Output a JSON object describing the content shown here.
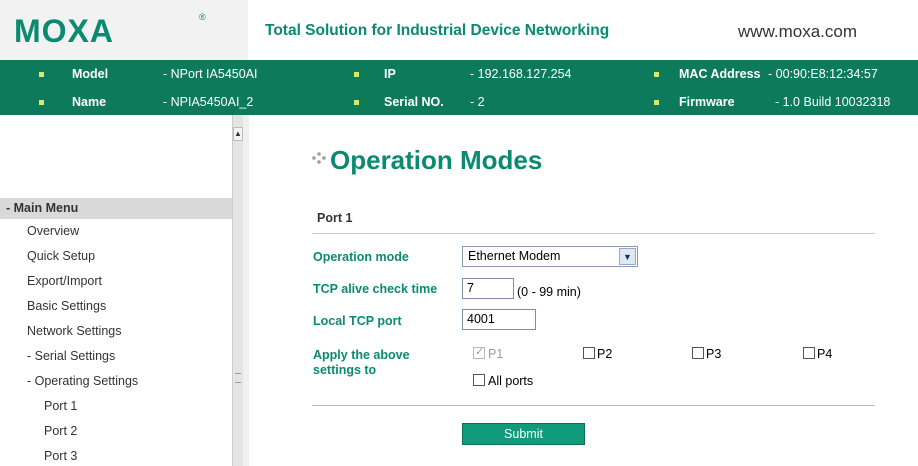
{
  "header": {
    "logo": "MOXA",
    "logo_mark": "®",
    "tagline": "Total Solution for Industrial Device Networking",
    "website": "www.moxa.com"
  },
  "info": {
    "model_label": "Model",
    "model_value": "- NPort IA5450AI",
    "name_label": "Name",
    "name_value": "- NPIA5450AI_2",
    "ip_label": "IP",
    "ip_value": "- 192.168.127.254",
    "serial_label": "Serial NO.",
    "serial_value": "- 2",
    "mac_label": "MAC Address",
    "mac_value": "- 00:90:E8:12:34:57",
    "firmware_label": "Firmware",
    "firmware_value": "- 1.0 Build 10032318"
  },
  "sidebar": {
    "menu_head": "- Main Menu",
    "items": [
      "Overview",
      "Quick Setup",
      "Export/Import",
      "Basic Settings",
      "Network Settings",
      "- Serial Settings",
      "- Operating Settings",
      "Port 1",
      "Port 2",
      "Port 3"
    ]
  },
  "main": {
    "title": "Operation Modes",
    "section": "Port 1",
    "operation_mode_label": "Operation mode",
    "operation_mode_value": "Ethernet Modem",
    "tcp_alive_label": "TCP alive check time",
    "tcp_alive_value": "7",
    "tcp_alive_hint": "(0 - 99 min)",
    "local_port_label": "Local TCP port",
    "local_port_value": "4001",
    "apply_label": "Apply the above settings to",
    "ports": [
      "P1",
      "P2",
      "P3",
      "P4"
    ],
    "all_ports": "All ports",
    "submit": "Submit"
  },
  "colors": {
    "brand": "#0a8a70",
    "infobar": "#0c7a5b",
    "submit": "#119b7a"
  }
}
